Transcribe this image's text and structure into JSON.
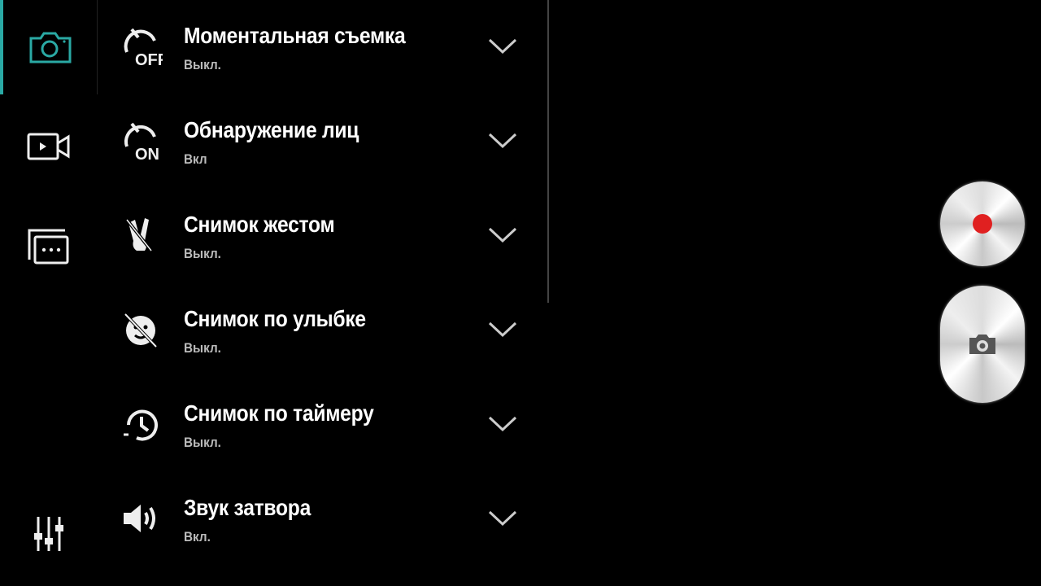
{
  "accent": "#2aa9a4",
  "sidebar": {
    "tabs": [
      {
        "name": "photo-settings",
        "icon": "camera-icon",
        "active": true
      },
      {
        "name": "video-settings",
        "icon": "video-camera-icon",
        "active": false
      },
      {
        "name": "other-settings",
        "icon": "more-windows-icon",
        "active": false
      },
      {
        "name": "adjustments",
        "icon": "sliders-icon",
        "active": false
      }
    ]
  },
  "settings": [
    {
      "title": "Моментальная съемка",
      "value": "Выкл.",
      "icon": "instant-off-icon"
    },
    {
      "title": "Обнаружение лиц",
      "value": "Вкл",
      "icon": "face-detect-on-icon"
    },
    {
      "title": "Снимок жестом",
      "value": "Выкл.",
      "icon": "gesture-off-icon"
    },
    {
      "title": "Снимок по улыбке",
      "value": "Выкл.",
      "icon": "smile-off-icon"
    },
    {
      "title": "Снимок по таймеру",
      "value": "Выкл.",
      "icon": "timer-icon"
    },
    {
      "title": "Звук затвора",
      "value": "Вкл.",
      "icon": "speaker-icon"
    }
  ],
  "controls": {
    "record": "record-button",
    "shutter": "shutter-button",
    "record_color": "#e02020"
  }
}
